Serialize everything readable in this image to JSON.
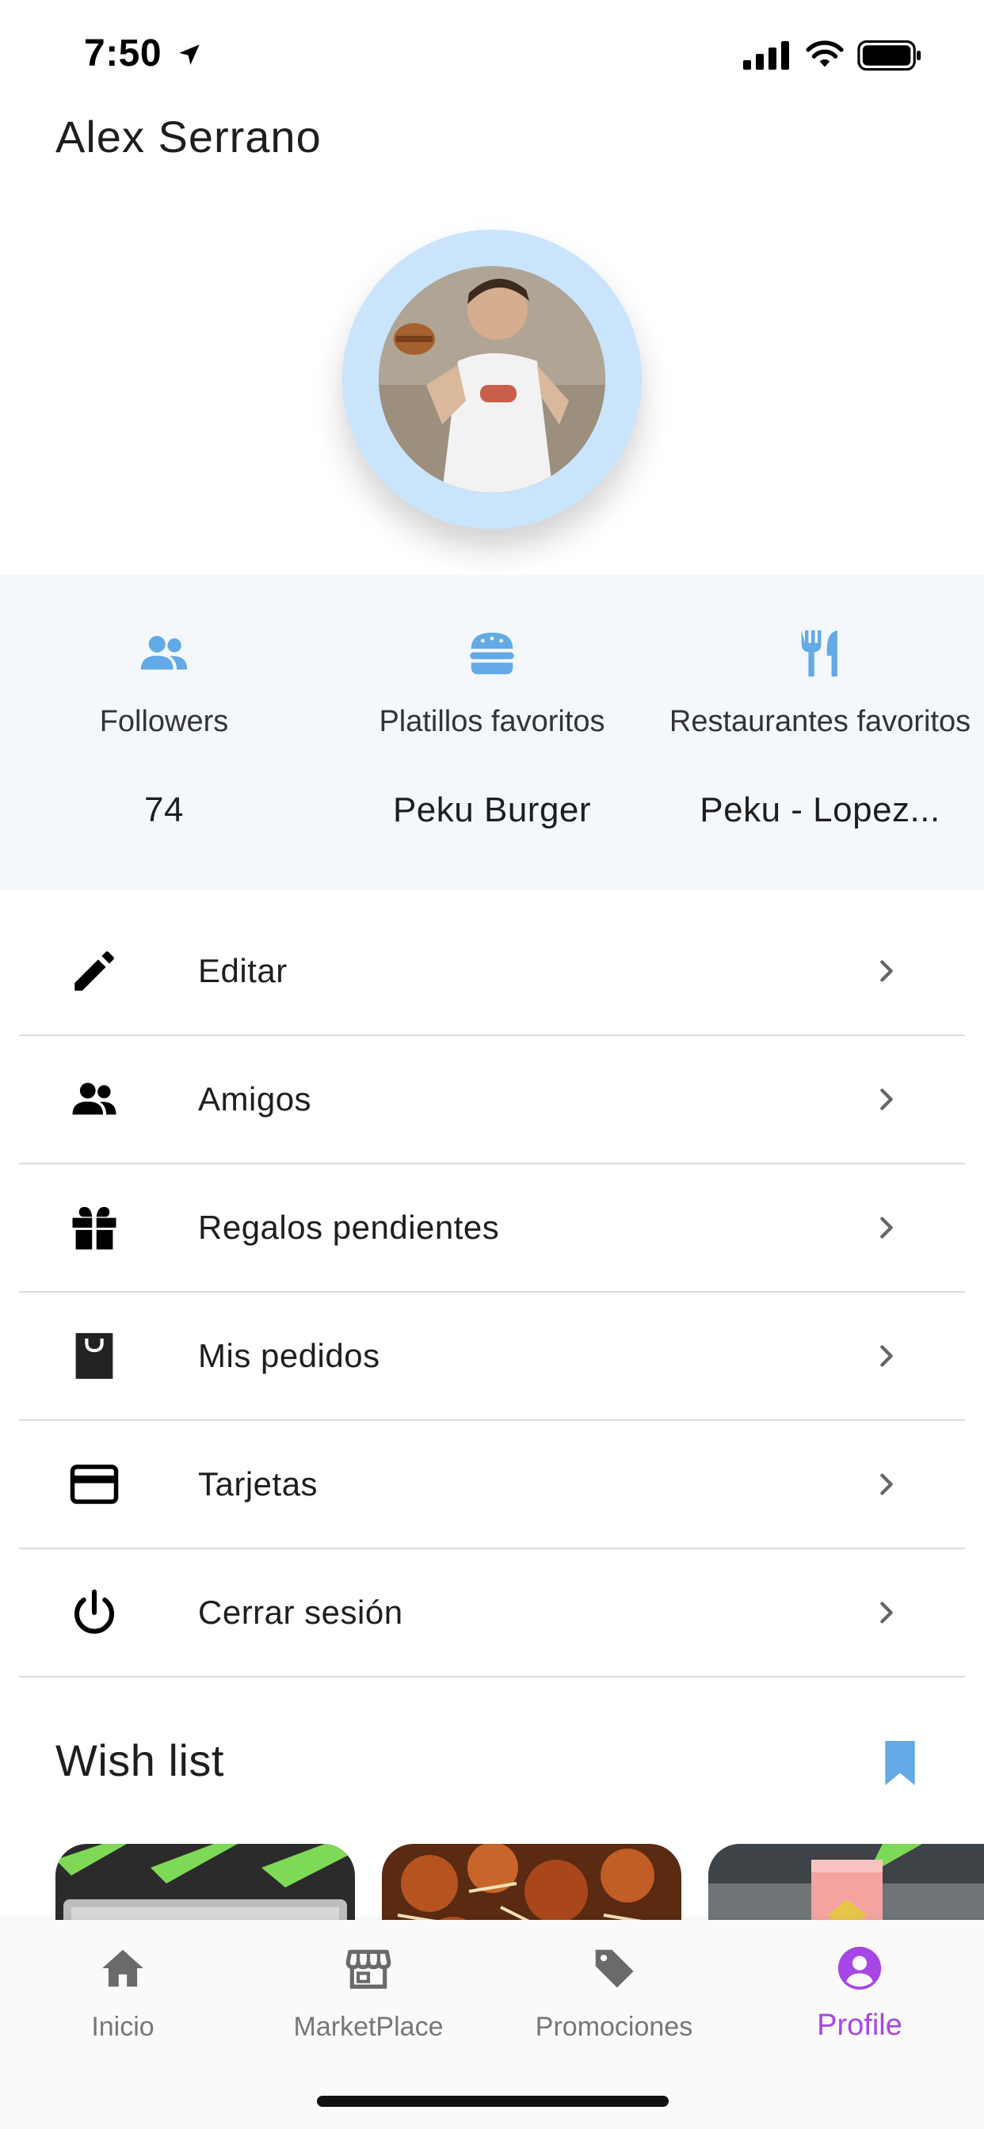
{
  "status_bar": {
    "time": "7:50"
  },
  "profile": {
    "name": "Alex  Serrano"
  },
  "stats": [
    {
      "icon": "people-icon",
      "label": "Followers",
      "value": "74"
    },
    {
      "icon": "burger-icon",
      "label": "Platillos favoritos",
      "value": "Peku Burger"
    },
    {
      "icon": "fork-knife-icon",
      "label": "Restaurantes favoritos",
      "value": "Peku - Lopez..."
    }
  ],
  "menu": [
    {
      "icon": "pencil-icon",
      "label": "Editar"
    },
    {
      "icon": "people-icon",
      "label": "Amigos"
    },
    {
      "icon": "gift-icon",
      "label": "Regalos pendientes"
    },
    {
      "icon": "shopping-bag-icon",
      "label": "Mis pedidos"
    },
    {
      "icon": "credit-card-icon",
      "label": "Tarjetas"
    },
    {
      "icon": "power-icon",
      "label": "Cerrar sesión"
    }
  ],
  "wish_list": {
    "title": "Wish list"
  },
  "bottom_nav": [
    {
      "icon": "home-icon",
      "label": "Inicio",
      "active": false
    },
    {
      "icon": "store-icon",
      "label": "MarketPlace",
      "active": false
    },
    {
      "icon": "tag-icon",
      "label": "Promociones",
      "active": false
    },
    {
      "icon": "profile-icon",
      "label": "Profile",
      "active": true
    }
  ],
  "colors": {
    "accent_blue": "#63a9e6",
    "active_purple": "#a647e5",
    "avatar_ring": "#c9e4fb",
    "stats_background": "#f4f8fc"
  }
}
